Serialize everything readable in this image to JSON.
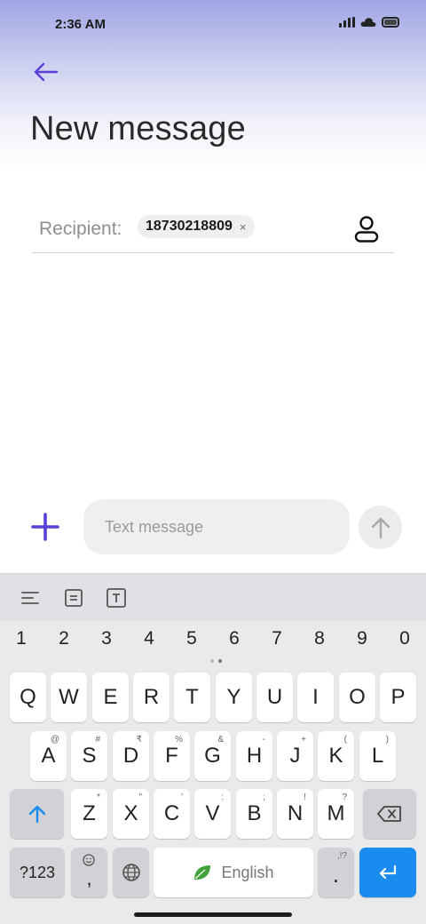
{
  "status": {
    "time": "2:36 AM",
    "icons": [
      "signal-icon",
      "cloud-icon",
      "battery-icon"
    ]
  },
  "header": {
    "title": "New message",
    "back_icon": "back-arrow-icon"
  },
  "recipient": {
    "label": "Recipient:",
    "chip": "18730218809",
    "chip_close": "×",
    "contact_icon": "contact-person-icon"
  },
  "compose": {
    "placeholder": "Text message",
    "add_icon": "plus-icon",
    "send_icon": "send-arrow-icon"
  },
  "keyboard": {
    "toolbar": [
      "text-align-icon",
      "clipboard-icon",
      "text-format-icon"
    ],
    "numbers": [
      "1",
      "2",
      "3",
      "4",
      "5",
      "6",
      "7",
      "8",
      "9",
      "0"
    ],
    "row1": [
      "Q",
      "W",
      "E",
      "R",
      "T",
      "Y",
      "U",
      "I",
      "O",
      "P"
    ],
    "row2": [
      "A",
      "S",
      "D",
      "F",
      "G",
      "H",
      "J",
      "K",
      "L"
    ],
    "row2_hints": [
      "@",
      "#",
      "₹",
      "%",
      "&",
      "-",
      "+",
      "(",
      ")"
    ],
    "row3": [
      "Z",
      "X",
      "C",
      "V",
      "B",
      "N",
      "M"
    ],
    "row3_hints": [
      "*",
      "\"",
      "'",
      ":",
      ";",
      "!",
      "?"
    ],
    "symbols_key": "?123",
    "comma_key": ",",
    "space_label": "English",
    "period_key": ".",
    "period_hint": ",!?"
  },
  "colors": {
    "accent": "#5b3fd6",
    "enter": "#1a8cf0"
  }
}
